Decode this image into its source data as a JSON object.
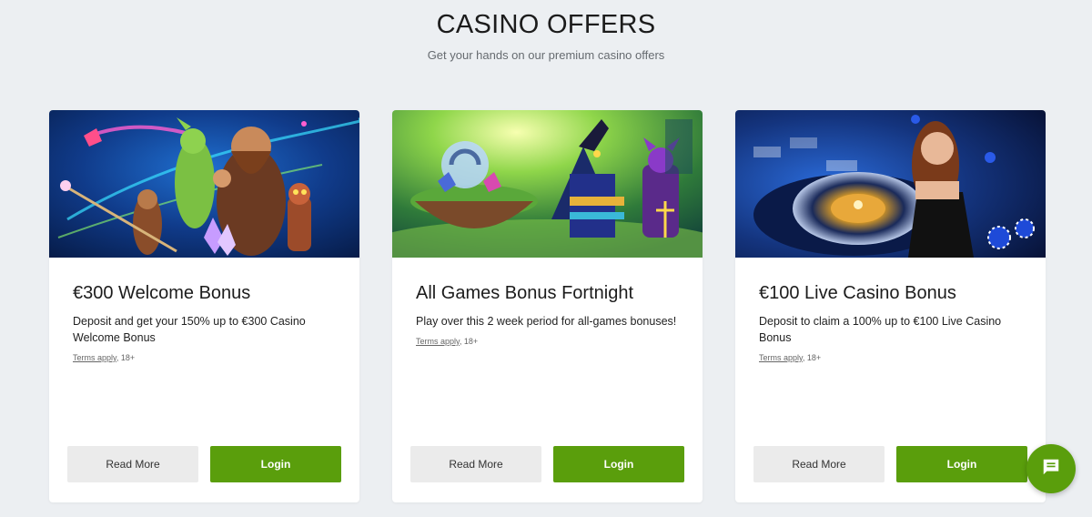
{
  "header": {
    "title": "CASINO OFFERS",
    "subtitle": "Get your hands on our premium casino offers"
  },
  "offers": [
    {
      "title": "€300 Welcome Bonus",
      "description": "Deposit and get your 150% up to €300 Casino Welcome Bonus",
      "terms_link": "Terms apply",
      "terms_suffix": ", 18+",
      "read_more_label": "Read More",
      "login_label": "Login",
      "image": "fantasy-characters-dragon-caveman-robot"
    },
    {
      "title": "All Games Bonus Fortnight",
      "description": "Play over this 2 week period for all-games bonuses!",
      "terms_link": "Terms apply",
      "terms_suffix": ", 18+",
      "read_more_label": "Read More",
      "login_label": "Login",
      "image": "egyptian-anubis-floating-island"
    },
    {
      "title": "€100 Live Casino Bonus",
      "description": "Deposit to claim a 100% up to €100 Live Casino Bonus",
      "terms_link": "Terms apply",
      "terms_suffix": ", 18+",
      "read_more_label": "Read More",
      "login_label": "Login",
      "image": "live-dealer-roulette-wheel"
    }
  ],
  "chat": {
    "icon": "chat-icon"
  },
  "colors": {
    "accent": "#5a9e0c",
    "background": "#eceff2",
    "secondary_button": "#ebebeb"
  }
}
